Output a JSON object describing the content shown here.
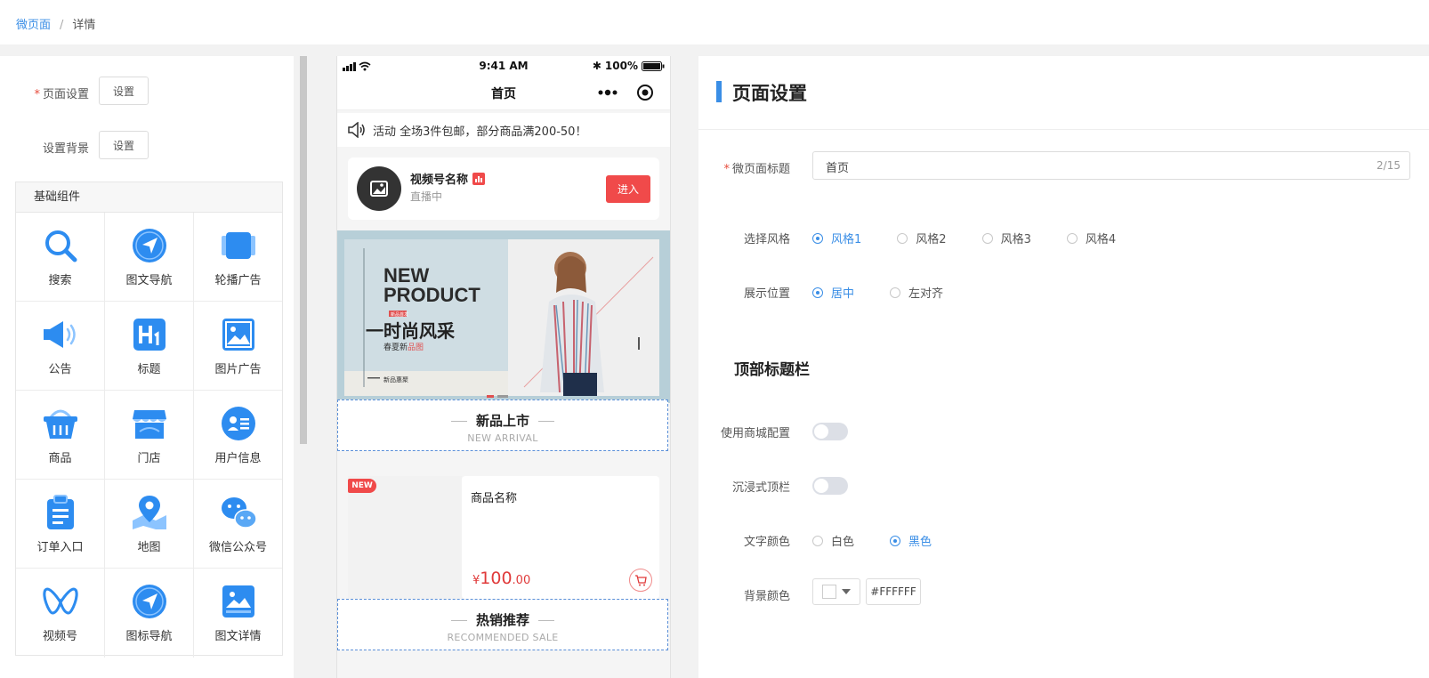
{
  "breadcrumb": {
    "parent": "微页面",
    "separator": "/",
    "current": "详情"
  },
  "left": {
    "page_setting": {
      "label": "页面设置",
      "button": "设置"
    },
    "background_setting": {
      "label": "设置背景",
      "button": "设置"
    },
    "components": {
      "title": "基础组件",
      "items": [
        {
          "label": "搜索",
          "icon": "search-icon"
        },
        {
          "label": "图文导航",
          "icon": "compass-nav-icon"
        },
        {
          "label": "轮播广告",
          "icon": "carousel-icon"
        },
        {
          "label": "公告",
          "icon": "megaphone-icon"
        },
        {
          "label": "标题",
          "icon": "heading-icon"
        },
        {
          "label": "图片广告",
          "icon": "image-icon"
        },
        {
          "label": "商品",
          "icon": "basket-icon"
        },
        {
          "label": "门店",
          "icon": "store-icon"
        },
        {
          "label": "用户信息",
          "icon": "user-card-icon"
        },
        {
          "label": "订单入口",
          "icon": "clipboard-icon"
        },
        {
          "label": "地图",
          "icon": "map-pin-icon"
        },
        {
          "label": "微信公众号",
          "icon": "wechat-icon"
        },
        {
          "label": "视频号",
          "icon": "channels-icon"
        },
        {
          "label": "图标导航",
          "icon": "compass-nav-icon"
        },
        {
          "label": "图文详情",
          "icon": "image-text-icon"
        }
      ]
    }
  },
  "phone": {
    "status": {
      "time": "9:41 AM",
      "battery": "100%"
    },
    "nav_title": "首页",
    "notice": "活动 全场3件包邮，部分商品满200-50！",
    "live": {
      "name": "视频号名称",
      "status": "直播中",
      "button": "进入"
    },
    "banner": {
      "headline_1": "NEW",
      "headline_2": "PRODUCT",
      "tag": "新品首发",
      "cn_title": "一时尚风采",
      "cn_sub_1": "春夏新",
      "cn_sub_2": "品图",
      "footer": "新品惠聚"
    },
    "section_new": {
      "zh": "新品上市",
      "en": "NEW ARRIVAL"
    },
    "product": {
      "badge": "NEW",
      "name": "商品名称",
      "currency": "¥",
      "price_int": "100",
      "price_dec": ".00"
    },
    "section_hot": {
      "zh": "热销推荐",
      "en": "RECOMMENDED SALE"
    }
  },
  "right": {
    "title": "页面设置",
    "page_title_field": {
      "label": "微页面标题",
      "value": "首页",
      "counter": "2/15"
    },
    "style": {
      "label": "选择风格",
      "options": [
        "风格1",
        "风格2",
        "风格3",
        "风格4"
      ],
      "selected": 0
    },
    "position": {
      "label": "展示位置",
      "options": [
        "居中",
        "左对齐"
      ],
      "selected": 0
    },
    "topbar_section": "顶部标题栏",
    "use_mall_config": {
      "label": "使用商城配置",
      "on": false
    },
    "immersive": {
      "label": "沉浸式顶栏",
      "on": false
    },
    "text_color": {
      "label": "文字颜色",
      "options": [
        "白色",
        "黑色"
      ],
      "selected": 1
    },
    "bg_color": {
      "label": "背景颜色",
      "value": "#FFFFFF"
    }
  },
  "colors": {
    "accent": "#3a8ee6",
    "danger": "#f04a4a"
  }
}
